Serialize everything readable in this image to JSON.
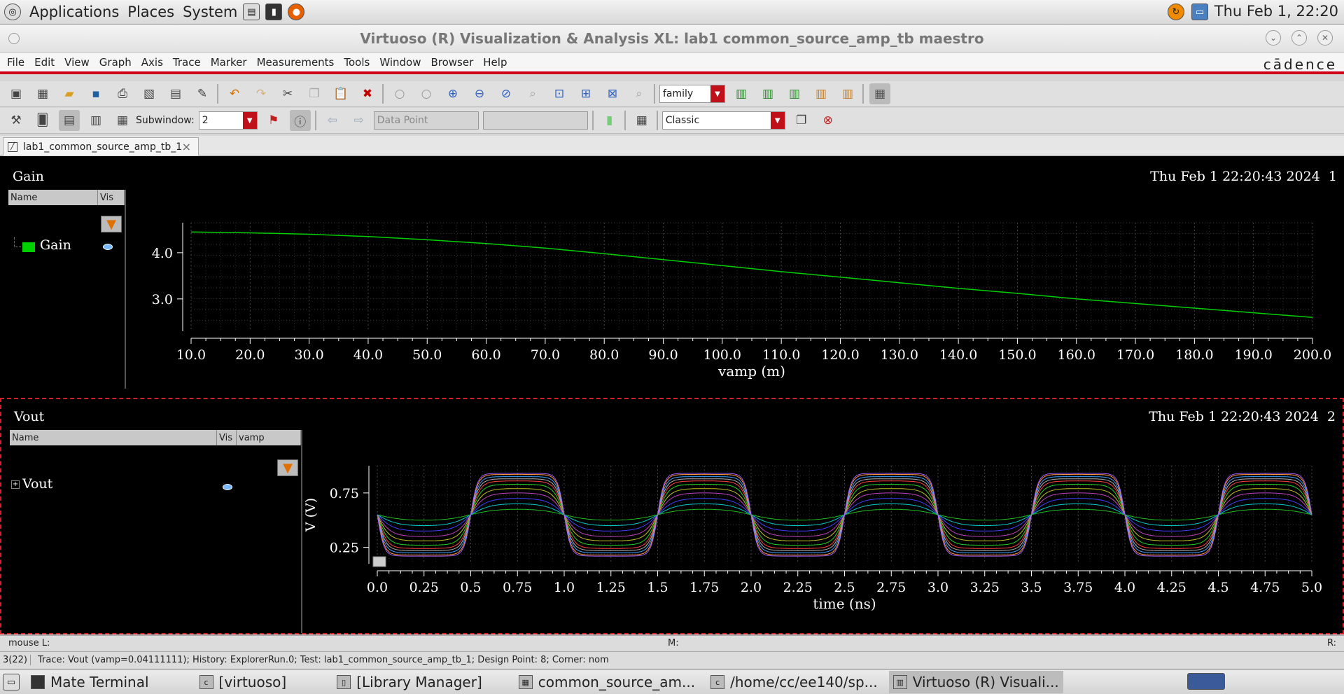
{
  "topbar": {
    "menus": [
      "Applications",
      "Places",
      "System"
    ],
    "clock": "Thu Feb  1, 22:20"
  },
  "window": {
    "title": "Virtuoso (R) Visualization & Analysis XL: lab1 common_source_amp_tb maestro",
    "brand": "cādence"
  },
  "menubar": [
    "File",
    "Edit",
    "View",
    "Graph",
    "Axis",
    "Trace",
    "Marker",
    "Measurements",
    "Tools",
    "Window",
    "Browser",
    "Help"
  ],
  "toolbar1": {
    "family_combo": "family"
  },
  "toolbar2": {
    "subwindow_label": "Subwindow:",
    "subwindow_value": "2",
    "datapoint_combo": "Data Point",
    "style_combo": "Classic"
  },
  "tab": {
    "label": "lab1_common_source_amp_tb_1",
    "close": "×"
  },
  "subwindow1": {
    "title": "Gain",
    "date": "Thu Feb 1 22:20:43 2024",
    "index": "1",
    "legend_headers": [
      "Name",
      "Vis"
    ],
    "trace_name": "Gain",
    "trace_color": "#00d000"
  },
  "subwindow2": {
    "title": "Vout",
    "date": "Thu Feb 1 22:20:43 2024",
    "index": "2",
    "legend_headers": [
      "Name",
      "Vis",
      "vamp"
    ],
    "trace_name": "Vout",
    "expander": "+"
  },
  "chart_data": [
    {
      "type": "line",
      "xlabel": "vamp (m)",
      "ylabel": "",
      "xlim": [
        10.0,
        200.0
      ],
      "ylim": [
        2.3,
        4.65
      ],
      "xticks": [
        "10.0",
        "20.0",
        "30.0",
        "40.0",
        "50.0",
        "60.0",
        "70.0",
        "80.0",
        "90.0",
        "100.0",
        "110.0",
        "120.0",
        "130.0",
        "140.0",
        "150.0",
        "160.0",
        "170.0",
        "180.0",
        "190.0",
        "200.0"
      ],
      "yticks": [
        "3.0",
        "4.0"
      ],
      "grid": true,
      "series": [
        {
          "name": "Gain",
          "color": "#00d000",
          "x": [
            10,
            20,
            30,
            40,
            50,
            60,
            70,
            80,
            90,
            100,
            110,
            120,
            130,
            140,
            150,
            160,
            170,
            180,
            190,
            200
          ],
          "y": [
            4.45,
            4.43,
            4.4,
            4.35,
            4.28,
            4.2,
            4.1,
            3.98,
            3.85,
            3.72,
            3.59,
            3.47,
            3.35,
            3.23,
            3.12,
            3.0,
            2.9,
            2.8,
            2.7,
            2.6
          ]
        }
      ]
    },
    {
      "type": "line",
      "xlabel": "time (ns)",
      "ylabel": "V (V)",
      "xlim": [
        0.0,
        5.0
      ],
      "ylim": [
        0.1,
        1.0
      ],
      "xticks": [
        "0.0",
        "0.25",
        "0.5",
        "0.75",
        "1.0",
        "1.25",
        "1.5",
        "1.75",
        "2.0",
        "2.25",
        "2.5",
        "2.75",
        "3.0",
        "3.25",
        "3.5",
        "3.75",
        "4.0",
        "4.25",
        "4.5",
        "4.75",
        "5.0"
      ],
      "yticks": [
        "0.25",
        "0.75"
      ],
      "grid": true,
      "offset": 0.55,
      "period_ns": 1.0,
      "series": [
        {
          "amplitude": 0.05,
          "color": "#20c020"
        },
        {
          "amplitude": 0.1,
          "color": "#00c8c8"
        },
        {
          "amplitude": 0.15,
          "color": "#4040ff"
        },
        {
          "amplitude": 0.2,
          "color": "#c040c0"
        },
        {
          "amplitude": 0.24,
          "color": "#c0c020"
        },
        {
          "amplitude": 0.28,
          "color": "#20d020"
        },
        {
          "amplitude": 0.31,
          "color": "#ff4040"
        },
        {
          "amplitude": 0.33,
          "color": "#b0b0b0"
        },
        {
          "amplitude": 0.35,
          "color": "#40a0ff"
        },
        {
          "amplitude": 0.37,
          "color": "#ff9040"
        },
        {
          "amplitude": 0.38,
          "color": "#a060ff"
        }
      ]
    }
  ],
  "status": {
    "mouse_l": "mouse L:",
    "mouse_m": "M:",
    "mouse_r": "R:",
    "count": "3(22)",
    "message": "Trace: Vout (vamp=0.04111111); History: ExplorerRun.0; Test: lab1_common_source_amp_tb_1; Design Point: 8; Corner: nom"
  },
  "taskbar": [
    "Mate Terminal",
    "[virtuoso]",
    "[Library Manager]",
    "common_source_am...",
    "/home/cc/ee140/sp...",
    "Virtuoso (R) Visuali..."
  ]
}
